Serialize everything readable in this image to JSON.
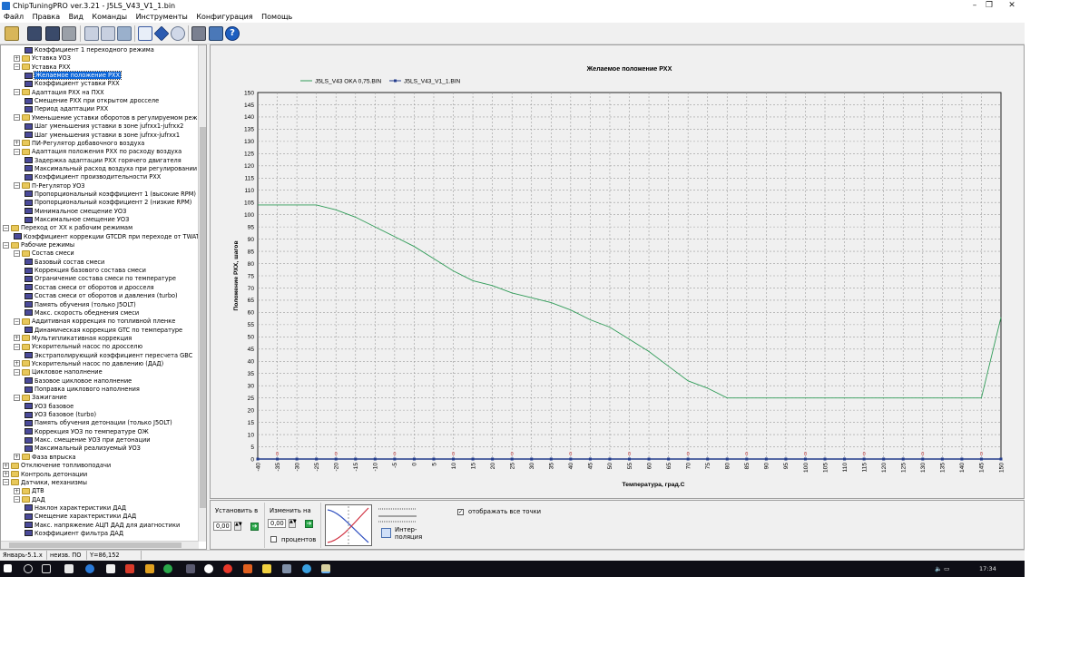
{
  "window": {
    "title": "ChipTuningPRO ver.3.21 - J5LS_V43_V1_1.bin",
    "controls": [
      "–",
      "❐",
      "✕"
    ]
  },
  "menu": [
    "Файл",
    "Правка",
    "Вид",
    "Команды",
    "Инструменты",
    "Конфигурация",
    "Помощь"
  ],
  "toolbar_icons": [
    "open-icon",
    "save-icon",
    "save-as-icon",
    "print-icon",
    "copy-icon",
    "paste-icon",
    "paste-special-icon",
    "undo-icon",
    "table-view-icon",
    "compare-icon",
    "search-icon",
    "tools-icon",
    "connect-icon",
    "help-icon"
  ],
  "tree": [
    {
      "depth": 5,
      "kind": "param",
      "label": "Коэффициент 1 переходного режима"
    },
    {
      "depth": 3,
      "kind": "folder",
      "exp": "+",
      "label": "Уставка УОЗ"
    },
    {
      "depth": 3,
      "kind": "folder",
      "exp": "−",
      "label": "Уставка РХХ"
    },
    {
      "depth": 5,
      "kind": "param",
      "label": "Желаемое положение РХХ",
      "selected": true
    },
    {
      "depth": 5,
      "kind": "param",
      "label": "Коэффициент уставки РХХ"
    },
    {
      "depth": 3,
      "kind": "folder",
      "exp": "−",
      "label": "Адаптация РХХ на ПХХ"
    },
    {
      "depth": 5,
      "kind": "param",
      "label": "Смещение РХХ при открытом дросселе"
    },
    {
      "depth": 5,
      "kind": "param",
      "label": "Период адаптации РХХ"
    },
    {
      "depth": 3,
      "kind": "folder",
      "exp": "−",
      "label": "Уменьшение уставки оборотов в регулируемом режиме"
    },
    {
      "depth": 5,
      "kind": "param",
      "label": "Шаг уменьшения уставки в зоне jufrxx1-jufrxx2"
    },
    {
      "depth": 5,
      "kind": "param",
      "label": "Шаг уменьшения уставки в зоне jufrxx-jufrxx1"
    },
    {
      "depth": 3,
      "kind": "folder",
      "exp": "+",
      "label": "ПИ-Регулятор добавочного воздуха"
    },
    {
      "depth": 3,
      "kind": "folder",
      "exp": "−",
      "label": "Адаптация положения РХХ по расходу воздуха"
    },
    {
      "depth": 5,
      "kind": "param",
      "label": "Задержка адаптации РХХ горячего двигателя"
    },
    {
      "depth": 5,
      "kind": "param",
      "label": "Максимальный расход воздуха при регулировании"
    },
    {
      "depth": 5,
      "kind": "param",
      "label": "Коэффициент производительности РХХ"
    },
    {
      "depth": 3,
      "kind": "folder",
      "exp": "−",
      "label": "П-Регулятор УОЗ"
    },
    {
      "depth": 5,
      "kind": "param",
      "label": "Пропорциональный коэффициент 1 (высокие RPM)"
    },
    {
      "depth": 5,
      "kind": "param",
      "label": "Пропорциональный коэффициент 2 (низкие RPM)"
    },
    {
      "depth": 5,
      "kind": "param",
      "label": "Минимальное смещение УОЗ"
    },
    {
      "depth": 5,
      "kind": "param",
      "label": "Максимальное смещение УОЗ"
    },
    {
      "depth": 1,
      "kind": "folder",
      "exp": "−",
      "label": "Переход от ХХ к рабочим режимам"
    },
    {
      "depth": 3,
      "kind": "param",
      "label": "Коэффициент коррекции GTCDR при переходе от TWAT"
    },
    {
      "depth": 1,
      "kind": "folder",
      "exp": "−",
      "label": "Рабочие режимы"
    },
    {
      "depth": 3,
      "kind": "folder",
      "exp": "−",
      "label": "Состав смеси"
    },
    {
      "depth": 5,
      "kind": "param",
      "label": "Базовый состав смеси"
    },
    {
      "depth": 5,
      "kind": "param",
      "label": "Коррекция базового состава смеси"
    },
    {
      "depth": 5,
      "kind": "param",
      "label": "Ограничение состава смеси по температуре"
    },
    {
      "depth": 5,
      "kind": "param",
      "label": "Состав смеси от оборотов и дросселя"
    },
    {
      "depth": 5,
      "kind": "param",
      "label": "Состав смеси от оборотов и давления (turbo)"
    },
    {
      "depth": 5,
      "kind": "param",
      "label": "Память обучения (только J5OLT)"
    },
    {
      "depth": 5,
      "kind": "param",
      "label": "Макс. скорость обеднения смеси"
    },
    {
      "depth": 3,
      "kind": "folder",
      "exp": "−",
      "label": "Аддитивная коррекция по топливной пленке"
    },
    {
      "depth": 5,
      "kind": "param",
      "label": "Динамическая коррекция GTC по температуре"
    },
    {
      "depth": 3,
      "kind": "folder",
      "exp": "+",
      "label": "Мультипликативная коррекция"
    },
    {
      "depth": 3,
      "kind": "folder",
      "exp": "−",
      "label": "Ускорительный насос по дросселю"
    },
    {
      "depth": 5,
      "kind": "param",
      "label": "Экстраполирующий коэффициент пересчета GBC"
    },
    {
      "depth": 3,
      "kind": "folder",
      "exp": "+",
      "label": "Ускорительный насос по давлению (ДАД)"
    },
    {
      "depth": 3,
      "kind": "folder",
      "exp": "−",
      "label": "Цикловое наполнение"
    },
    {
      "depth": 5,
      "kind": "param",
      "label": "Базовое цикловое наполнение"
    },
    {
      "depth": 5,
      "kind": "param",
      "label": "Поправка циклового наполнения"
    },
    {
      "depth": 3,
      "kind": "folder",
      "exp": "−",
      "label": "Зажигание"
    },
    {
      "depth": 5,
      "kind": "param",
      "label": "УОЗ базовое"
    },
    {
      "depth": 5,
      "kind": "param",
      "label": "УОЗ базовое (turbo)"
    },
    {
      "depth": 5,
      "kind": "param",
      "label": "Память обучения детонации (только J5OLT)"
    },
    {
      "depth": 5,
      "kind": "param",
      "label": "Коррекция УОЗ по температуре ОЖ"
    },
    {
      "depth": 5,
      "kind": "param",
      "label": "Макс. смещение УОЗ при детонации"
    },
    {
      "depth": 5,
      "kind": "param",
      "label": "Максимальный реализуемый УОЗ"
    },
    {
      "depth": 3,
      "kind": "folder",
      "exp": "+",
      "label": "Фаза впрыска"
    },
    {
      "depth": 1,
      "kind": "folder",
      "exp": "+",
      "label": "Отключение топливоподачи"
    },
    {
      "depth": 1,
      "kind": "folder",
      "exp": "+",
      "label": "Контроль детонации"
    },
    {
      "depth": 1,
      "kind": "folder",
      "exp": "−",
      "label": "Датчики, механизмы"
    },
    {
      "depth": 3,
      "kind": "folder",
      "exp": "+",
      "label": "ДТВ"
    },
    {
      "depth": 3,
      "kind": "folder",
      "exp": "−",
      "label": "ДАД"
    },
    {
      "depth": 5,
      "kind": "param",
      "label": "Наклон характеристики ДАД"
    },
    {
      "depth": 5,
      "kind": "param",
      "label": "Смещение характеристики ДАД"
    },
    {
      "depth": 5,
      "kind": "param",
      "label": "Макс. напряжение АЦП ДАД для диагностики"
    },
    {
      "depth": 5,
      "kind": "param",
      "label": "Коэффициент фильтра ДАД"
    }
  ],
  "chart_data": {
    "type": "line",
    "title": "Желаемое положение РХХ",
    "xlabel": "Температура, град.С",
    "ylabel": "Положение РХХ, шагов",
    "x": [
      -40,
      -35,
      -30,
      -25,
      -20,
      -15,
      -10,
      -5,
      0,
      5,
      10,
      15,
      20,
      25,
      30,
      35,
      40,
      45,
      50,
      55,
      60,
      65,
      70,
      75,
      80,
      85,
      90,
      95,
      100,
      105,
      110,
      115,
      120,
      125,
      130,
      135,
      140,
      145,
      150
    ],
    "x_tick_labels": [
      "-40",
      "-35",
      "-30",
      "-25",
      "-20",
      "-15",
      "-10",
      "-5",
      "0",
      "5",
      "10",
      "15",
      "20",
      "25",
      "30",
      "35",
      "40",
      "45",
      "50",
      "55",
      "60",
      "65",
      "70",
      "75",
      "80",
      "85",
      "90",
      "95",
      "100",
      "105",
      "110",
      "115",
      "120",
      "125",
      "130",
      "135",
      "140",
      "145",
      "150"
    ],
    "ylim": [
      0,
      150
    ],
    "y_tick_labels": [
      "0",
      "5",
      "10",
      "15",
      "20",
      "25",
      "30",
      "35",
      "40",
      "45",
      "50",
      "55",
      "60",
      "65",
      "70",
      "75",
      "80",
      "85",
      "90",
      "95",
      "100",
      "105",
      "110",
      "115",
      "120",
      "125",
      "130",
      "135",
      "140",
      "145",
      "150"
    ],
    "grid": true,
    "legend_position": "top-left",
    "series": [
      {
        "name": "J5LS_V43 OKA 0,75.BIN",
        "color": "#2f9b57",
        "values": [
          104,
          104,
          104,
          104,
          102,
          99,
          95,
          91,
          87,
          82,
          77,
          73,
          71,
          68,
          66,
          64,
          61,
          57,
          54,
          49,
          44,
          38,
          32,
          29,
          25,
          25,
          25,
          25,
          25,
          25,
          25,
          25,
          25,
          25,
          25,
          25,
          25,
          25,
          58
        ]
      },
      {
        "name": "J5LS_V43_V1_1.BIN",
        "color": "#233c8c",
        "values": [
          0,
          0,
          0,
          0,
          0,
          0,
          0,
          0,
          0,
          0,
          0,
          0,
          0,
          0,
          0,
          0,
          0,
          0,
          0,
          0,
          0,
          0,
          0,
          0,
          0,
          0,
          0,
          0,
          0,
          0,
          0,
          0,
          0,
          0,
          0,
          0,
          0,
          0,
          0
        ]
      }
    ],
    "zero_marker_label": "0"
  },
  "bottom": {
    "set_label": "Установить в",
    "set_value": "0,00",
    "change_label": "Изменить на",
    "change_value": "0,00",
    "percent_label": "процентов",
    "interp_label_1": "Интер-",
    "interp_label_2": "поляция",
    "show_points_label": "отображать все точки"
  },
  "status": {
    "ecu": "Январь-5.1.х",
    "software": "неизв. ПО",
    "coords": "Y=86,152"
  },
  "tray": {
    "time": "17:34"
  }
}
